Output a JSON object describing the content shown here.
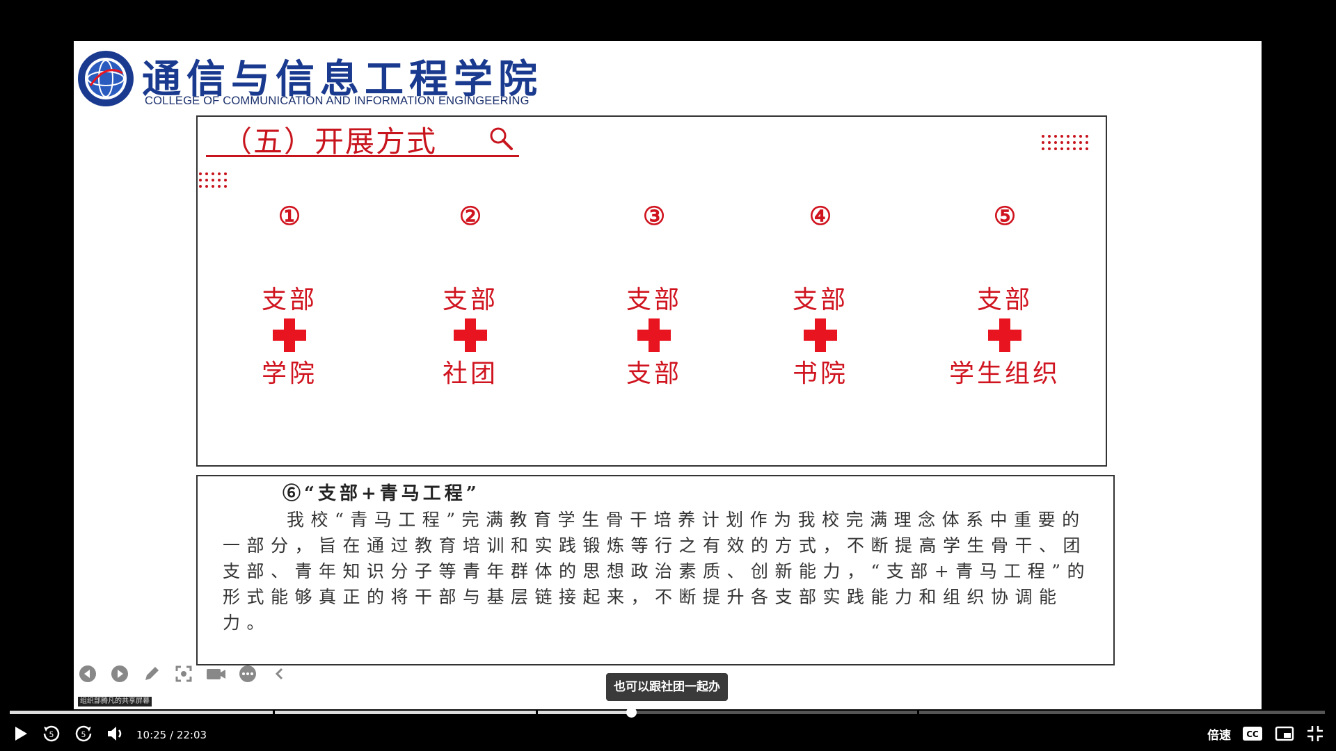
{
  "slide": {
    "college_name_cn": "通信与信息工程学院",
    "college_name_en": "COLLEGE OF COMMUNICATION AND INFORMATION ENGINGEERING",
    "section_title": "（五）开展方式",
    "columns": [
      {
        "number": "①",
        "top": "支部",
        "bottom": "学院"
      },
      {
        "number": "②",
        "top": "支部",
        "bottom": "社团"
      },
      {
        "number": "③",
        "top": "支部",
        "bottom": "支部"
      },
      {
        "number": "④",
        "top": "支部",
        "bottom": "书院"
      },
      {
        "number": "⑤",
        "top": "支部",
        "bottom": "学生组织"
      }
    ],
    "item6": {
      "title": "⑥“支部+青马工程”",
      "paragraph": "我校“青马工程”完满教育学生骨干培养计划作为我校完满理念体系中重要的一部分，旨在通过教育培训和实践锻炼等行之有效的方式，不断提高学生骨干、团支部、青年知识分子等青年群体的思想政治素质、创新能力，“支部+青马工程”的形式能够真正的将干部与基层链接起来，不断提升各支部实践能力和组织协调能力。"
    },
    "accent_color": "#c8141d",
    "brand_color": "#1a3a8f"
  },
  "annotation_toolbar": {
    "icons": [
      "prev-page-icon",
      "next-page-icon",
      "pen-icon",
      "screenshot-icon",
      "camera-icon",
      "more-icon",
      "collapse-icon"
    ]
  },
  "share_label": "组织部腾凡的共享屏幕",
  "subtitle": "也可以跟社团一起办",
  "player": {
    "current_time": "10:25",
    "total_time": "22:03",
    "time_text": "10:25 / 22:03",
    "progress_fraction": 0.4725,
    "chapter_fractions": [
      0.2,
      0.4,
      0.69
    ],
    "speed_label": "倍速",
    "cc_label": "CC",
    "skip_seconds": "5"
  }
}
